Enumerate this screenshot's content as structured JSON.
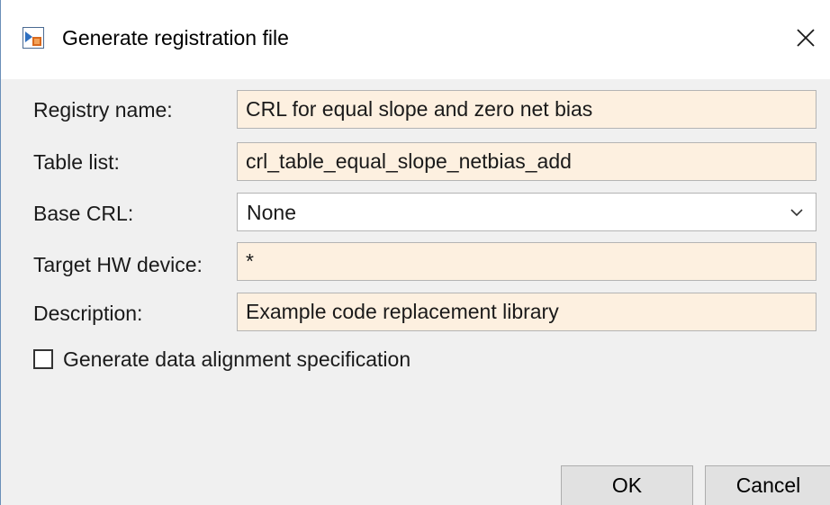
{
  "window": {
    "title": "Generate registration file",
    "icon": "matlab-app-icon",
    "close_icon": "close-icon"
  },
  "form": {
    "registry_name": {
      "label": "Registry name:",
      "value": "CRL for equal slope and zero net bias"
    },
    "table_list": {
      "label": "Table list:",
      "value": "crl_table_equal_slope_netbias_add"
    },
    "base_crl": {
      "label": "Base CRL:",
      "value": "None"
    },
    "target_hw": {
      "label": "Target HW device:",
      "value": "*"
    },
    "description": {
      "label": "Description:",
      "value": "Example code replacement library"
    }
  },
  "checkbox": {
    "label": "Generate data alignment specification",
    "checked": false
  },
  "buttons": {
    "ok": "OK",
    "cancel": "Cancel"
  },
  "colors": {
    "editable_field_bg": "#fdf0e0",
    "dialog_bg": "#f0f0f0",
    "button_bg": "#e1e1e1"
  }
}
